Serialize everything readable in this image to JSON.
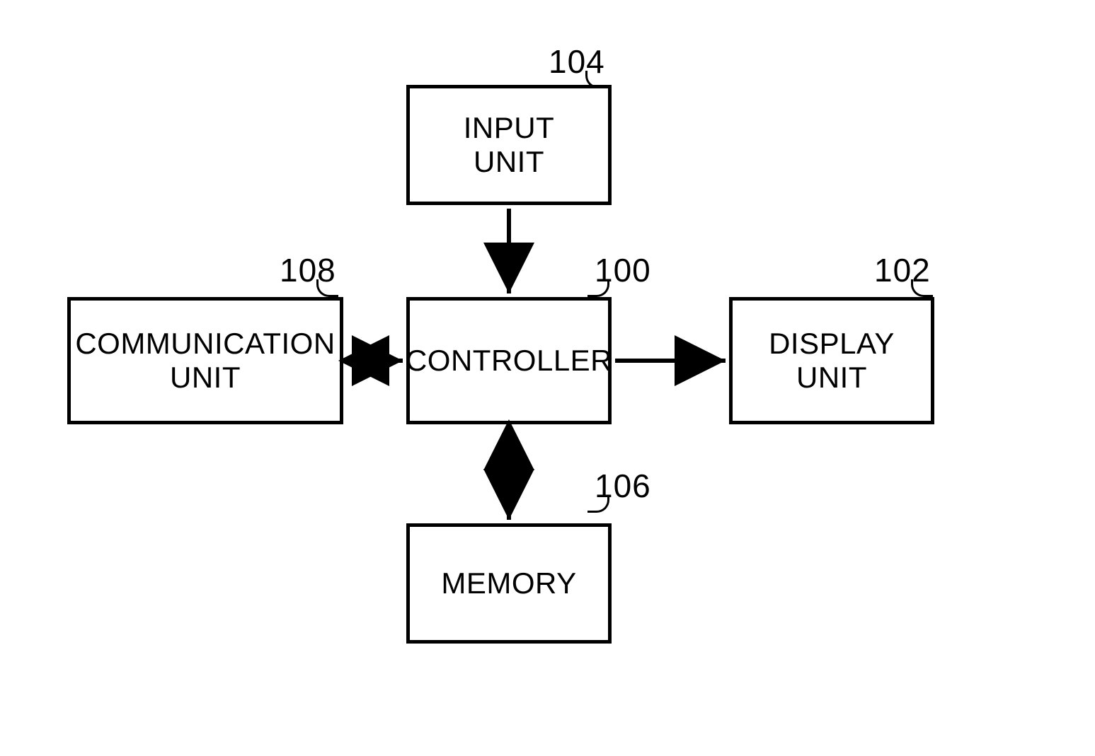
{
  "diagram": {
    "blocks": {
      "input": {
        "label": "INPUT\nUNIT",
        "ref": "104"
      },
      "communication": {
        "label": "COMMUNICATION\nUNIT",
        "ref": "108"
      },
      "controller": {
        "label": "CONTROLLER",
        "ref": "100"
      },
      "display": {
        "label": "DISPLAY\nUNIT",
        "ref": "102"
      },
      "memory": {
        "label": "MEMORY",
        "ref": "106"
      }
    },
    "connections": [
      {
        "from": "input",
        "to": "controller",
        "type": "uni"
      },
      {
        "from": "communication",
        "to": "controller",
        "type": "bidi"
      },
      {
        "from": "controller",
        "to": "display",
        "type": "uni"
      },
      {
        "from": "controller",
        "to": "memory",
        "type": "bidi"
      }
    ]
  }
}
